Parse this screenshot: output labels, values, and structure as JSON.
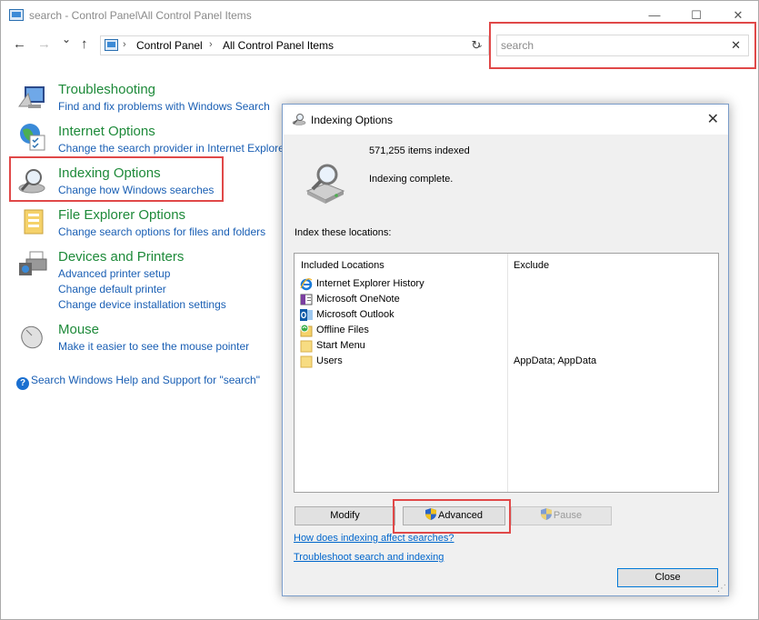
{
  "window": {
    "title": "search - Control Panel\\All Control Panel Items",
    "minimize": "—",
    "maximize": "☐",
    "close": "✕"
  },
  "nav": {
    "back": "←",
    "forward": "→",
    "recent": "⌄",
    "up": "↑",
    "address_dropdown": "⌄",
    "refresh": "↻",
    "breadcrumbs": [
      "Control Panel",
      "All Control Panel Items"
    ],
    "crumb_separator": "›"
  },
  "search": {
    "value": "search",
    "clear": "✕"
  },
  "results": [
    {
      "title": "Troubleshooting",
      "links": [
        "Find and fix problems with Windows Search"
      ],
      "icon": "troubleshooting-icon"
    },
    {
      "title": "Internet Options",
      "links": [
        "Change the search provider in Internet Explorer"
      ],
      "icon": "internet-options-icon"
    },
    {
      "title": "Indexing Options",
      "links": [
        "Change how Windows searches"
      ],
      "icon": "indexing-options-icon"
    },
    {
      "title": "File Explorer Options",
      "links": [
        "Change search options for files and folders"
      ],
      "icon": "file-explorer-options-icon"
    },
    {
      "title": "Devices and Printers",
      "links": [
        "Advanced printer setup",
        "Change default printer",
        "Change device installation settings"
      ],
      "icon": "devices-printers-icon"
    },
    {
      "title": "Mouse",
      "links": [
        "Make it easier to see the mouse pointer"
      ],
      "icon": "mouse-icon"
    }
  ],
  "help": {
    "text": "Search Windows Help and Support for \"search\"",
    "icon": "?"
  },
  "dialog": {
    "title": "Indexing Options",
    "close": "✕",
    "items_indexed": "571,255 items indexed",
    "status": "Indexing complete.",
    "section_label": "Index these locations:",
    "columns": {
      "included": "Included Locations",
      "exclude": "Exclude"
    },
    "locations": [
      {
        "name": "Internet Explorer History",
        "exclude": "",
        "icon": "ie-icon"
      },
      {
        "name": "Microsoft OneNote",
        "exclude": "",
        "icon": "onenote-icon"
      },
      {
        "name": "Microsoft Outlook",
        "exclude": "",
        "icon": "outlook-icon"
      },
      {
        "name": "Offline Files",
        "exclude": "",
        "icon": "offline-files-icon"
      },
      {
        "name": "Start Menu",
        "exclude": "",
        "icon": "folder-icon"
      },
      {
        "name": "Users",
        "exclude": "AppData; AppData",
        "icon": "folder-icon"
      }
    ],
    "buttons": {
      "modify": "Modify",
      "advanced": "Advanced",
      "pause": "Pause",
      "close": "Close"
    },
    "links": {
      "how": "How does indexing affect searches?",
      "troubleshoot": "Troubleshoot search and indexing"
    },
    "grip": "⋰"
  },
  "colors": {
    "result_title": "#1e8a3a",
    "link": "#1a5fb4",
    "highlight": "#e04848",
    "dialog_bg": "#f0f0f0"
  }
}
